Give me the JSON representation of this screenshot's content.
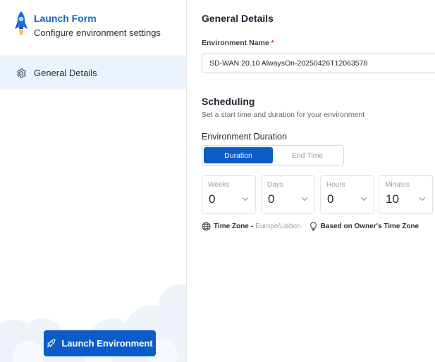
{
  "brand": {
    "title": "Launch Form",
    "subtitle": "Configure environment settings"
  },
  "sidebar": {
    "items": [
      {
        "label": "General Details",
        "icon": "gear-icon",
        "active": true
      }
    ],
    "launch_button": {
      "label": "Launch Environment",
      "icon": "rocket-icon"
    }
  },
  "main": {
    "general": {
      "heading": "General Details",
      "env_name_label": "Environment Name",
      "required_mark": "*",
      "env_name_value": "SD-WAN 20.10 AlwaysOn-20250426T12063578"
    },
    "scheduling": {
      "heading": "Scheduling",
      "description": "Set a start time and duration for your environment",
      "duration_label": "Environment Duration",
      "toggle": {
        "options": [
          "Duration",
          "End Time"
        ],
        "selected": "Duration"
      },
      "steppers": [
        {
          "label": "Weeks",
          "value": "0"
        },
        {
          "label": "Days",
          "value": "0"
        },
        {
          "label": "Hours",
          "value": "0"
        },
        {
          "label": "Minutes",
          "value": "10"
        }
      ],
      "timezone": {
        "label": "Time Zone",
        "dash": "-",
        "value": "Europe/Lisbon",
        "owner_note": "Based on Owner's Time Zone"
      }
    }
  },
  "colors": {
    "accent": "#0b5cc9",
    "brand_title": "#1565c0",
    "active_nav_bg": "#eaf2fd",
    "required": "#d32f2f"
  }
}
